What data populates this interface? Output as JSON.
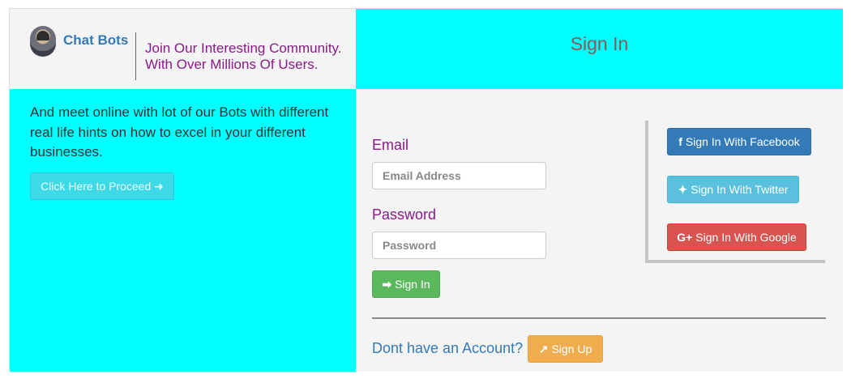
{
  "header": {
    "brand_name": "Chat Bots",
    "tagline_line1": "Join Our Interesting Community.",
    "tagline_line2": "With Over Millions Of Users.",
    "signin_title": "Sign In"
  },
  "intro": {
    "text": "And meet online with lot of our Bots with different real life hints on how to excel in your different businesses.",
    "proceed_label": "Click Here to Proceed",
    "proceed_icon": "arrow-right-icon"
  },
  "form": {
    "email_label": "Email",
    "email_placeholder": "Email Address",
    "email_value": "",
    "password_label": "Password",
    "password_placeholder": "Password",
    "password_value": "",
    "signin_label": "Sign In",
    "signin_icon": "sign-in-icon"
  },
  "social": {
    "facebook_label": "Sign In With Facebook",
    "twitter_label": "Sign In With Twitter",
    "google_label": "Sign In With Google"
  },
  "footer": {
    "no_account_text": "Dont have an Account?",
    "signup_label": "Sign Up",
    "signup_icon": "external-link-icon"
  },
  "colors": {
    "cyan_panel": "#00ffff",
    "purple_text": "#8a1a8a",
    "link_blue": "#337ab7",
    "success": "#5cb85c",
    "facebook": "#337ab7",
    "twitter": "#5bc0de",
    "google": "#d9534f",
    "warning": "#f0ad4e"
  }
}
